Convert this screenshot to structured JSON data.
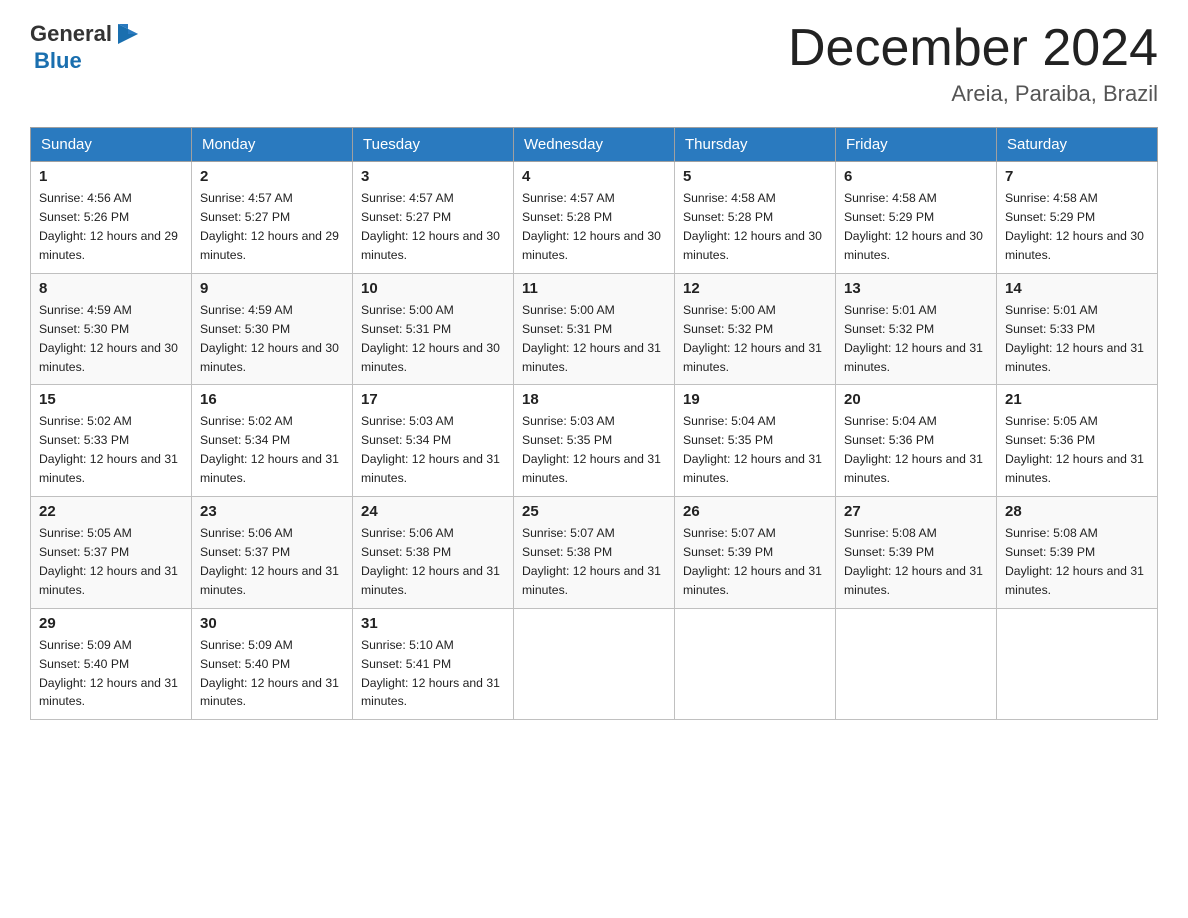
{
  "header": {
    "logo_general": "General",
    "logo_blue": "Blue",
    "month_year": "December 2024",
    "location": "Areia, Paraiba, Brazil"
  },
  "days_of_week": [
    "Sunday",
    "Monday",
    "Tuesday",
    "Wednesday",
    "Thursday",
    "Friday",
    "Saturday"
  ],
  "weeks": [
    [
      {
        "day": "1",
        "sunrise": "4:56 AM",
        "sunset": "5:26 PM",
        "daylight": "12 hours and 29 minutes."
      },
      {
        "day": "2",
        "sunrise": "4:57 AM",
        "sunset": "5:27 PM",
        "daylight": "12 hours and 29 minutes."
      },
      {
        "day": "3",
        "sunrise": "4:57 AM",
        "sunset": "5:27 PM",
        "daylight": "12 hours and 30 minutes."
      },
      {
        "day": "4",
        "sunrise": "4:57 AM",
        "sunset": "5:28 PM",
        "daylight": "12 hours and 30 minutes."
      },
      {
        "day": "5",
        "sunrise": "4:58 AM",
        "sunset": "5:28 PM",
        "daylight": "12 hours and 30 minutes."
      },
      {
        "day": "6",
        "sunrise": "4:58 AM",
        "sunset": "5:29 PM",
        "daylight": "12 hours and 30 minutes."
      },
      {
        "day": "7",
        "sunrise": "4:58 AM",
        "sunset": "5:29 PM",
        "daylight": "12 hours and 30 minutes."
      }
    ],
    [
      {
        "day": "8",
        "sunrise": "4:59 AM",
        "sunset": "5:30 PM",
        "daylight": "12 hours and 30 minutes."
      },
      {
        "day": "9",
        "sunrise": "4:59 AM",
        "sunset": "5:30 PM",
        "daylight": "12 hours and 30 minutes."
      },
      {
        "day": "10",
        "sunrise": "5:00 AM",
        "sunset": "5:31 PM",
        "daylight": "12 hours and 30 minutes."
      },
      {
        "day": "11",
        "sunrise": "5:00 AM",
        "sunset": "5:31 PM",
        "daylight": "12 hours and 31 minutes."
      },
      {
        "day": "12",
        "sunrise": "5:00 AM",
        "sunset": "5:32 PM",
        "daylight": "12 hours and 31 minutes."
      },
      {
        "day": "13",
        "sunrise": "5:01 AM",
        "sunset": "5:32 PM",
        "daylight": "12 hours and 31 minutes."
      },
      {
        "day": "14",
        "sunrise": "5:01 AM",
        "sunset": "5:33 PM",
        "daylight": "12 hours and 31 minutes."
      }
    ],
    [
      {
        "day": "15",
        "sunrise": "5:02 AM",
        "sunset": "5:33 PM",
        "daylight": "12 hours and 31 minutes."
      },
      {
        "day": "16",
        "sunrise": "5:02 AM",
        "sunset": "5:34 PM",
        "daylight": "12 hours and 31 minutes."
      },
      {
        "day": "17",
        "sunrise": "5:03 AM",
        "sunset": "5:34 PM",
        "daylight": "12 hours and 31 minutes."
      },
      {
        "day": "18",
        "sunrise": "5:03 AM",
        "sunset": "5:35 PM",
        "daylight": "12 hours and 31 minutes."
      },
      {
        "day": "19",
        "sunrise": "5:04 AM",
        "sunset": "5:35 PM",
        "daylight": "12 hours and 31 minutes."
      },
      {
        "day": "20",
        "sunrise": "5:04 AM",
        "sunset": "5:36 PM",
        "daylight": "12 hours and 31 minutes."
      },
      {
        "day": "21",
        "sunrise": "5:05 AM",
        "sunset": "5:36 PM",
        "daylight": "12 hours and 31 minutes."
      }
    ],
    [
      {
        "day": "22",
        "sunrise": "5:05 AM",
        "sunset": "5:37 PM",
        "daylight": "12 hours and 31 minutes."
      },
      {
        "day": "23",
        "sunrise": "5:06 AM",
        "sunset": "5:37 PM",
        "daylight": "12 hours and 31 minutes."
      },
      {
        "day": "24",
        "sunrise": "5:06 AM",
        "sunset": "5:38 PM",
        "daylight": "12 hours and 31 minutes."
      },
      {
        "day": "25",
        "sunrise": "5:07 AM",
        "sunset": "5:38 PM",
        "daylight": "12 hours and 31 minutes."
      },
      {
        "day": "26",
        "sunrise": "5:07 AM",
        "sunset": "5:39 PM",
        "daylight": "12 hours and 31 minutes."
      },
      {
        "day": "27",
        "sunrise": "5:08 AM",
        "sunset": "5:39 PM",
        "daylight": "12 hours and 31 minutes."
      },
      {
        "day": "28",
        "sunrise": "5:08 AM",
        "sunset": "5:39 PM",
        "daylight": "12 hours and 31 minutes."
      }
    ],
    [
      {
        "day": "29",
        "sunrise": "5:09 AM",
        "sunset": "5:40 PM",
        "daylight": "12 hours and 31 minutes."
      },
      {
        "day": "30",
        "sunrise": "5:09 AM",
        "sunset": "5:40 PM",
        "daylight": "12 hours and 31 minutes."
      },
      {
        "day": "31",
        "sunrise": "5:10 AM",
        "sunset": "5:41 PM",
        "daylight": "12 hours and 31 minutes."
      },
      null,
      null,
      null,
      null
    ]
  ]
}
